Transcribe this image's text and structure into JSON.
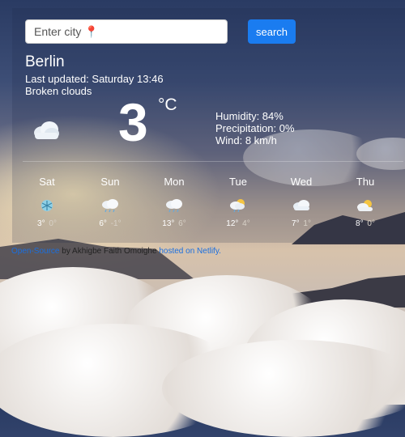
{
  "search": {
    "placeholder": "Enter city 📍",
    "button_label": "search"
  },
  "current": {
    "city": "Berlin",
    "last_updated": "Last updated: Saturday 13:46",
    "description": "Broken clouds",
    "temperature": "3",
    "unit": "°C",
    "icon": "cloud-icon",
    "humidity": "Humidity: 84%",
    "precipitation": "Precipitation: 0%",
    "wind": "Wind: 8 km/h"
  },
  "forecast": [
    {
      "day": "Sat",
      "icon": "snowflake-icon",
      "max": "3°",
      "min": "0°"
    },
    {
      "day": "Sun",
      "icon": "cloud-rain-icon",
      "max": "6°",
      "min": "-1°"
    },
    {
      "day": "Mon",
      "icon": "cloud-rain-icon",
      "max": "13°",
      "min": "6°"
    },
    {
      "day": "Tue",
      "icon": "sun-cloud-rain-icon",
      "max": "12°",
      "min": "4°"
    },
    {
      "day": "Wed",
      "icon": "cloud-icon",
      "max": "7°",
      "min": "1°"
    },
    {
      "day": "Thu",
      "icon": "sun-cloud-icon",
      "max": "8°",
      "min": "0°"
    }
  ],
  "footer": {
    "open_source": "Open-Source",
    "by_text": " by Akhigbe Faith Omoighe ",
    "hosted": "hosted on Netlify."
  },
  "colors": {
    "button": "#1a7cf0",
    "link": "#1a6fe0"
  }
}
